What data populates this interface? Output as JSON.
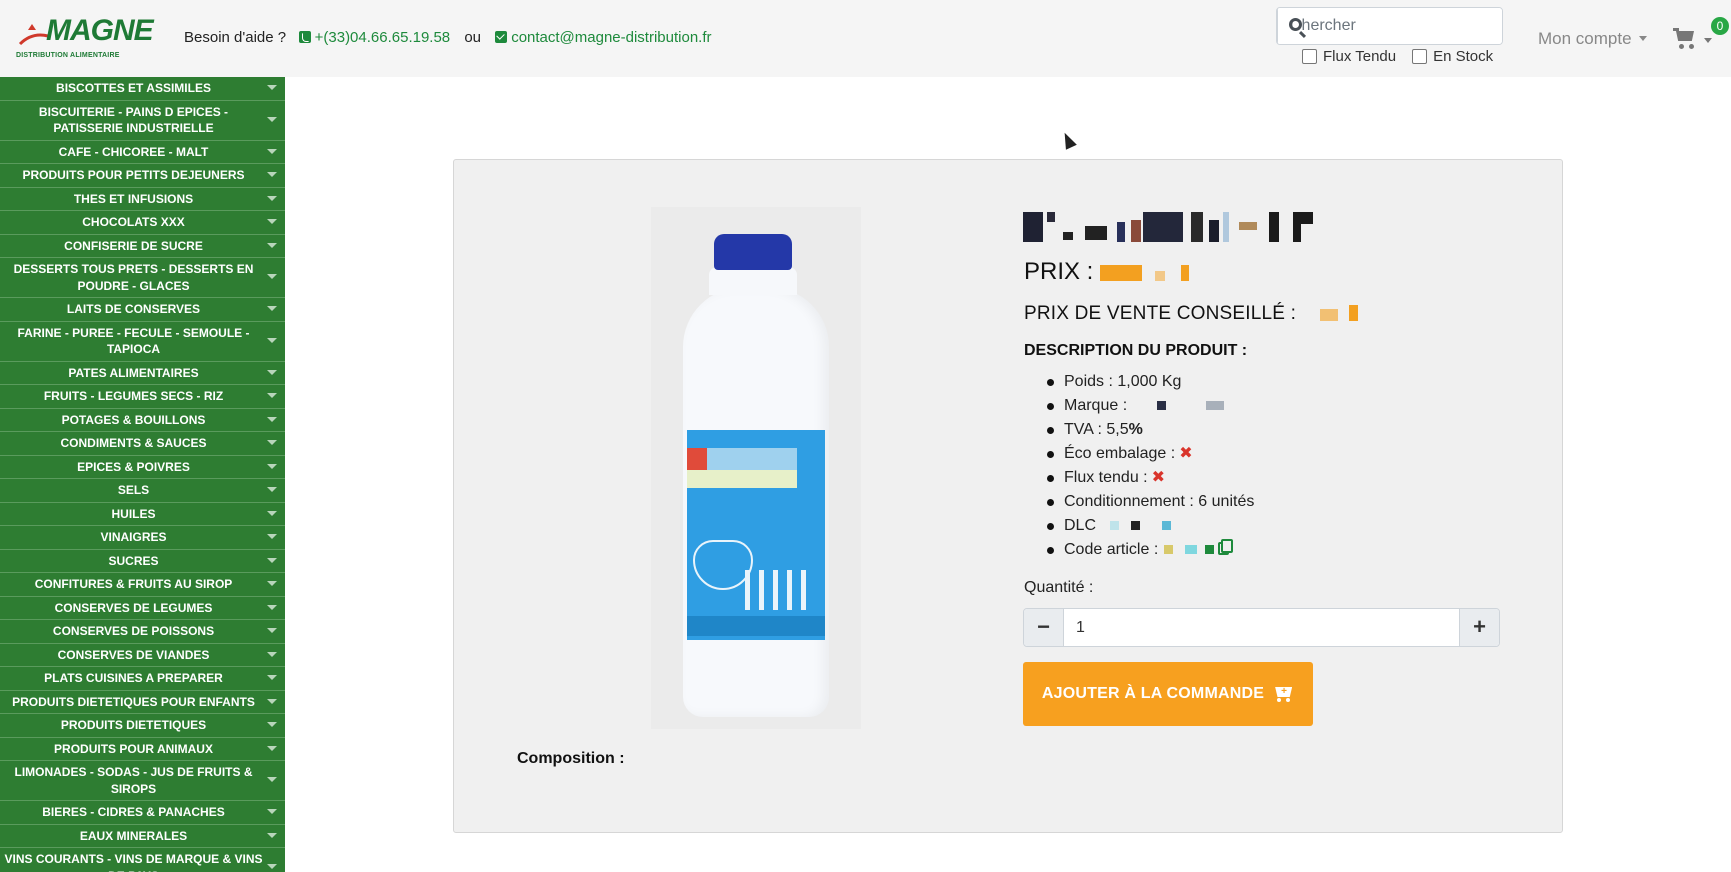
{
  "brand": {
    "name": "MAGNE",
    "tagline": "DISTRIBUTION ALIMENTAIRE",
    "color": "#1e7a35"
  },
  "header": {
    "help_label": "Besoin d'aide ?",
    "phone": "+(33)04.66.65.19.58",
    "or_label": "ou",
    "email": "contact@magne-distribution.fr",
    "search_placeholder": "Chercher",
    "filter_flux": "Flux Tendu",
    "filter_stock": "En Stock",
    "account_label": "Mon compte",
    "cart_count": "0"
  },
  "sidebar": {
    "background": "#2e7d32",
    "items": [
      "BISCOTTES ET ASSIMILES",
      "BISCUITERIE - PAINS D EPICES - PATISSERIE INDUSTRIELLE",
      "CAFE - CHICOREE - MALT",
      "PRODUITS POUR PETITS DEJEUNERS",
      "THES ET INFUSIONS",
      "CHOCOLATS XXX",
      "CONFISERIE DE SUCRE",
      "DESSERTS TOUS PRETS - DESSERTS EN POUDRE - GLACES",
      "LAITS DE CONSERVES",
      "FARINE - PUREE - FECULE - SEMOULE - TAPIOCA",
      "PATES ALIMENTAIRES",
      "FRUITS - LEGUMES SECS - RIZ",
      "POTAGES & BOUILLONS",
      "CONDIMENTS & SAUCES",
      "EPICES & POIVRES",
      "SELS",
      "HUILES",
      "VINAIGRES",
      "SUCRES",
      "CONFITURES & FRUITS AU SIROP",
      "CONSERVES DE LEGUMES",
      "CONSERVES DE POISSONS",
      "CONSERVES DE VIANDES",
      "PLATS CUISINES A PREPARER",
      "PRODUITS DIETETIQUES POUR ENFANTS",
      "PRODUITS DIETETIQUES",
      "PRODUITS POUR ANIMAUX",
      "LIMONADES - SODAS - JUS DE FRUITS & SIROPS",
      "BIERES - CIDRES & PANACHES",
      "EAUX MINERALES",
      "VINS COURANTS - VINS DE MARQUE & VINS DE PAYS"
    ]
  },
  "product": {
    "price_label": "PRIX :",
    "rrp_label": "PRIX DE VENTE CONSEILLÉ :",
    "desc_title": "DESCRIPTION DU PRODUIT :",
    "attrs": {
      "poids": "Poids : 1,000 Kg",
      "marque": "Marque :",
      "tva": "TVA : 5,5",
      "tva_unit": "%",
      "eco": "Éco embalage :",
      "flux": "Flux tendu :",
      "cond": "Conditionnement : 6 unités",
      "dlc": "DLC",
      "code": "Code article :"
    },
    "x_mark": "✖",
    "qty_label": "Quantité :",
    "qty_value": "1",
    "qty_minus": "−",
    "qty_plus": "+",
    "add_button": "AJOUTER À LA COMMANDE",
    "composition_label": "Composition :",
    "accent_orange": "#f7a01f"
  }
}
